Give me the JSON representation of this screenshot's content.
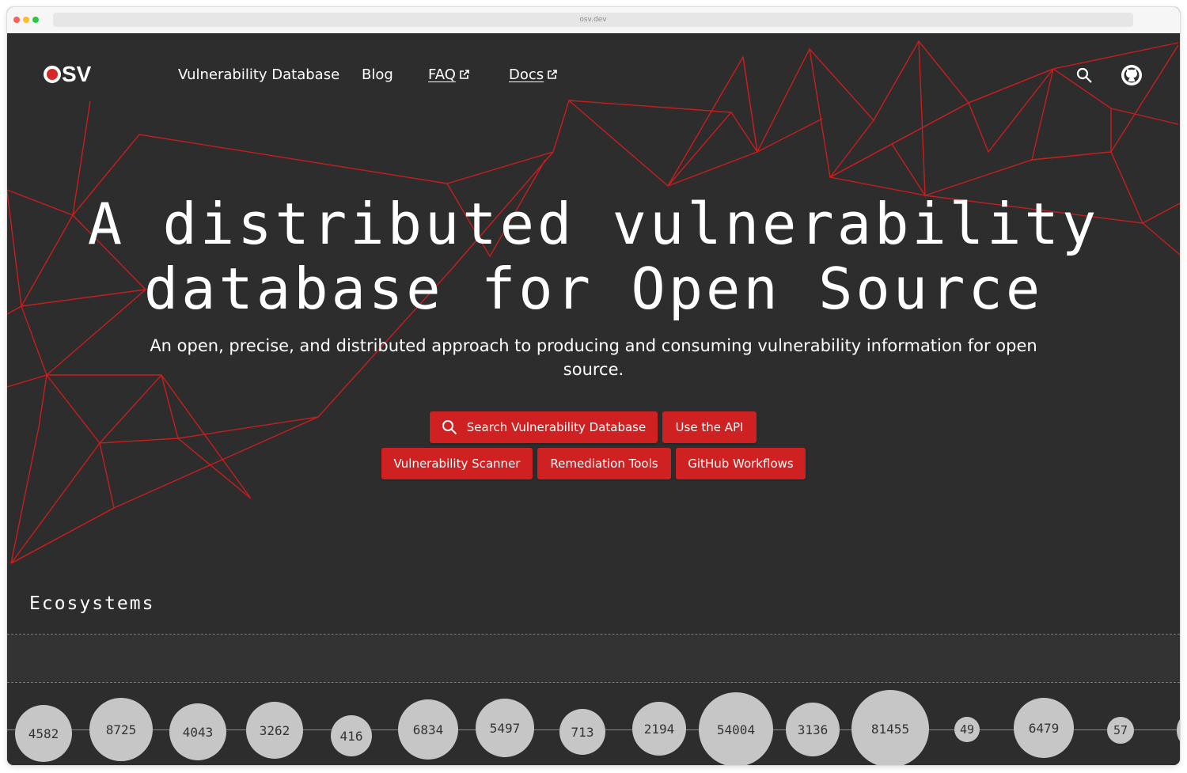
{
  "browser": {
    "url": "osv.dev"
  },
  "header": {
    "logo_text": "SV",
    "nav": [
      {
        "label": "Vulnerability Database"
      },
      {
        "label": "Blog"
      },
      {
        "label": "FAQ"
      },
      {
        "label": "Docs"
      }
    ]
  },
  "hero": {
    "title_line1": "A distributed vulnerability",
    "title_line2": "database for Open Source",
    "subtitle": "An open, precise, and distributed approach to producing and consuming vulnerability information for open source."
  },
  "buttons": {
    "search": "Search Vulnerability Database",
    "api": "Use the API",
    "scanner": "Vulnerability Scanner",
    "remediation": "Remediation Tools",
    "workflows": "GitHub Workflows"
  },
  "ecosystems": {
    "title": "Ecosystems",
    "counts": [
      "4582",
      "8725",
      "4043",
      "3262",
      "416",
      "6834",
      "5497",
      "713",
      "2194",
      "54004",
      "3136",
      "81455",
      "49",
      "6479",
      "57"
    ]
  },
  "colors": {
    "accent": "#cf2121",
    "background": "#2d2d2d",
    "lines": "#c81e1e",
    "bubble": "#c6c6c6"
  }
}
